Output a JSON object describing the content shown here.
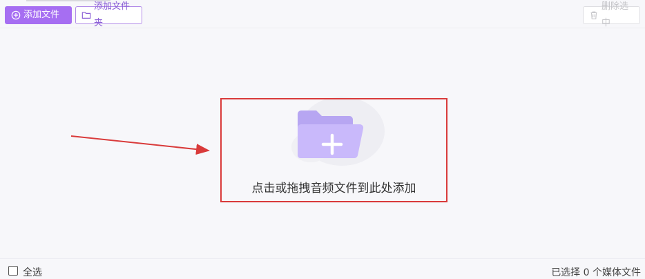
{
  "toolbar": {
    "add_file_label": "添加文件",
    "add_folder_label": "添加文件夹",
    "delete_selected_label": "删除选中"
  },
  "drop_area": {
    "hint": "点击或拖拽音频文件到此处添加"
  },
  "footer": {
    "select_all_label": "全选",
    "selection_status": "已选择 0 个媒体文件"
  },
  "colors": {
    "accent": "#a66ef2",
    "highlight_frame": "#d93a3a",
    "annotation_arrow": "#d93a3a"
  },
  "icons": {
    "add_file": "plus-circle-icon",
    "add_folder": "folder-icon",
    "delete": "trash-icon",
    "illustration": "folder-plus-icon"
  }
}
